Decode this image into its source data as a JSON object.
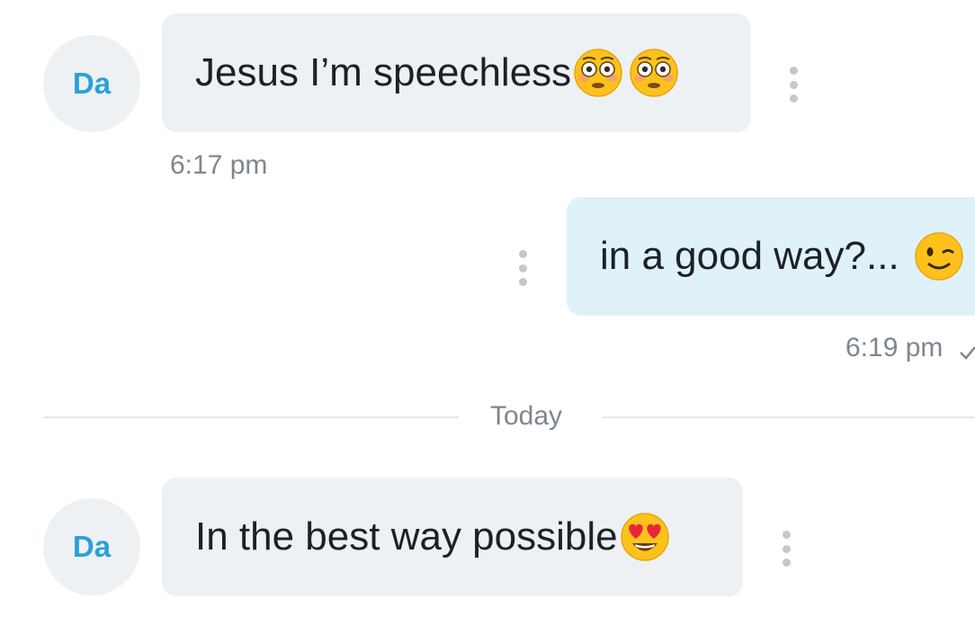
{
  "messages": [
    {
      "sender": "incoming",
      "avatar_initials": "Da",
      "text": "Jesus I’m speechless",
      "emojis": [
        "flushed-face-emoji",
        "flushed-face-emoji"
      ],
      "time": "6:17 pm"
    },
    {
      "sender": "outgoing",
      "text": "in a good way?...",
      "emojis": [
        "winking-face-emoji"
      ],
      "time": "6:19 pm",
      "status": "sent-check-icon"
    },
    {
      "sender": "incoming",
      "avatar_initials": "Da",
      "text": "In the best way possible",
      "emojis": [
        "heart-eyes-emoji"
      ]
    }
  ],
  "date_divider": {
    "label": "Today"
  },
  "colors": {
    "incoming_bubble": "#eef1f3",
    "outgoing_bubble": "#dff2f9",
    "avatar_text": "#2aa1d8",
    "timestamp": "#7d8790"
  }
}
